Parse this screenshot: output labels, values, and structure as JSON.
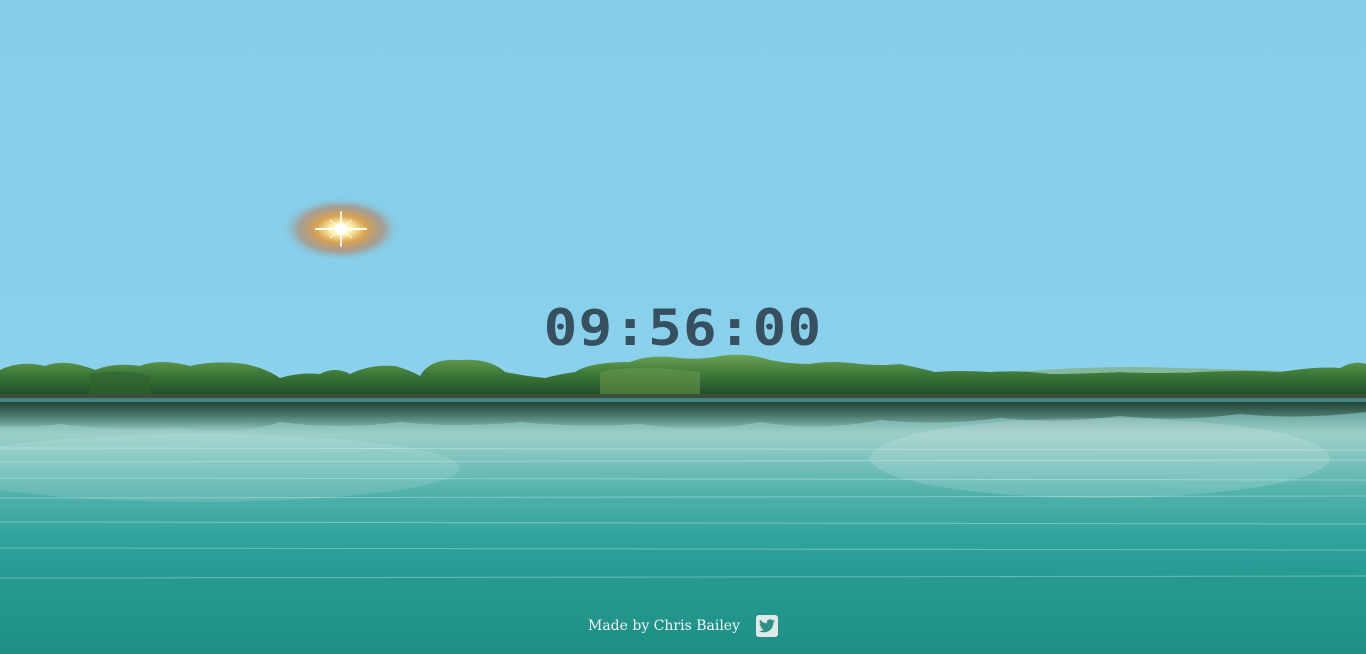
{
  "clock": {
    "time": "09:56:00"
  },
  "footer": {
    "credit": "Made by Chris Bailey",
    "social_icon": "twitter-icon"
  },
  "colors": {
    "sky": "#86ceeb",
    "clock_text": "#37505f",
    "water": "#2fa39c",
    "trees": "#3f7a3a"
  }
}
